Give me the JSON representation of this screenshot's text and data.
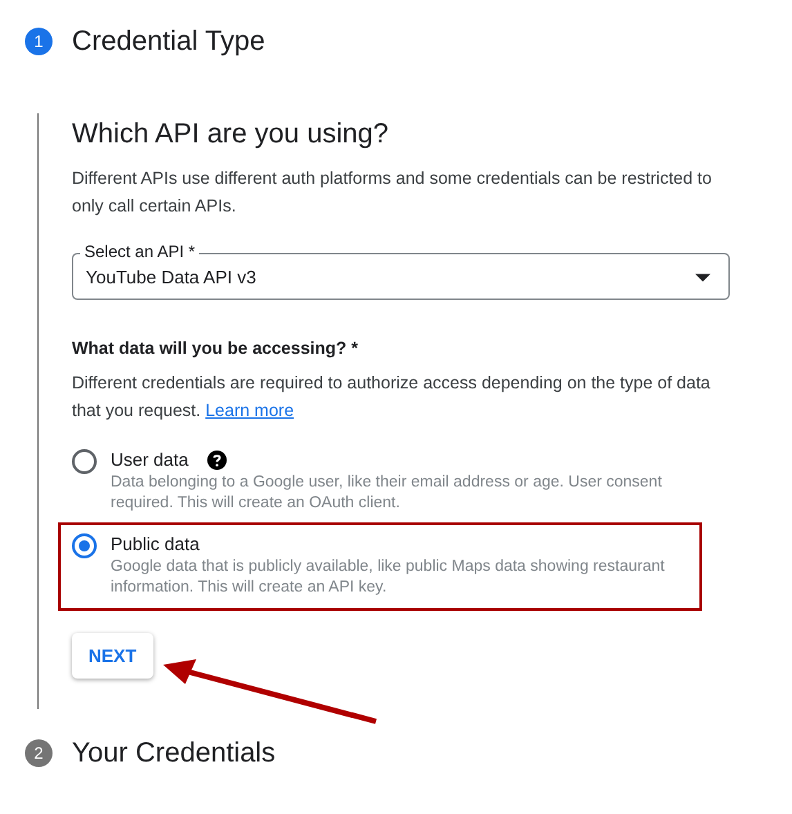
{
  "steps": [
    {
      "number": "1",
      "title": "Credential Type",
      "active": true
    },
    {
      "number": "2",
      "title": "Your Credentials",
      "active": false
    }
  ],
  "api_section": {
    "heading": "Which API are you using?",
    "description": "Different APIs use different auth platforms and some credentials can be restricted to only call certain APIs.",
    "select": {
      "label": "Select an API *",
      "value": "YouTube Data API v3"
    }
  },
  "data_section": {
    "question": "What data will you be accessing? *",
    "description": "Different credentials are required to authorize access depending on the type of data that you request.",
    "link": "Learn more",
    "options": [
      {
        "label": "User data",
        "description": "Data belonging to a Google user, like their email address or age. User consent required. This will create an OAuth client.",
        "selected": false,
        "help": true,
        "highlighted": false
      },
      {
        "label": "Public data",
        "description": "Google data that is publicly available, like public Maps data showing restaurant information. This will create an API key.",
        "selected": true,
        "help": false,
        "highlighted": true
      }
    ]
  },
  "next_button": "NEXT",
  "arrow_to_next": true
}
